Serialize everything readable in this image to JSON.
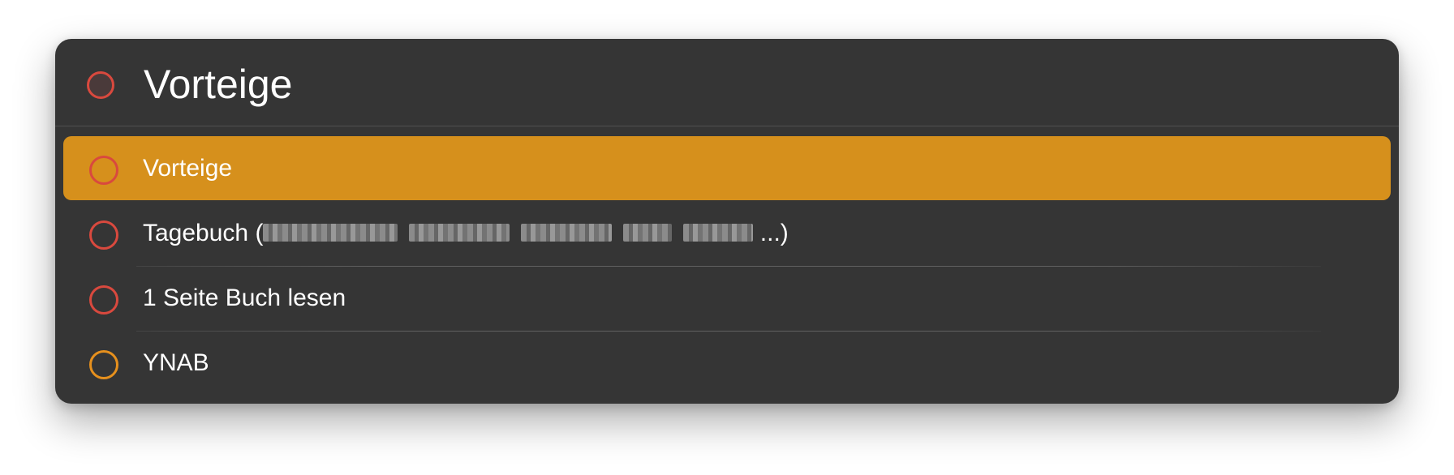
{
  "search": {
    "query": "Vorteige",
    "icon": "circle-outline-icon",
    "icon_color": "#d9493e"
  },
  "results": [
    {
      "label": "Vorteige",
      "selected": true,
      "ring_color": "#d9493e"
    },
    {
      "label_prefix": "Tagebuch (",
      "label_suffix": " ...)",
      "redacted": true,
      "selected": false,
      "ring_color": "#d9493e"
    },
    {
      "label": "1 Seite Buch lesen",
      "selected": false,
      "ring_color": "#d9493e"
    },
    {
      "label": "YNAB",
      "selected": false,
      "ring_color": "#e6901d"
    }
  ],
  "colors": {
    "panel_bg": "#353535",
    "selection": "#d6901c",
    "text": "#ffffff"
  }
}
